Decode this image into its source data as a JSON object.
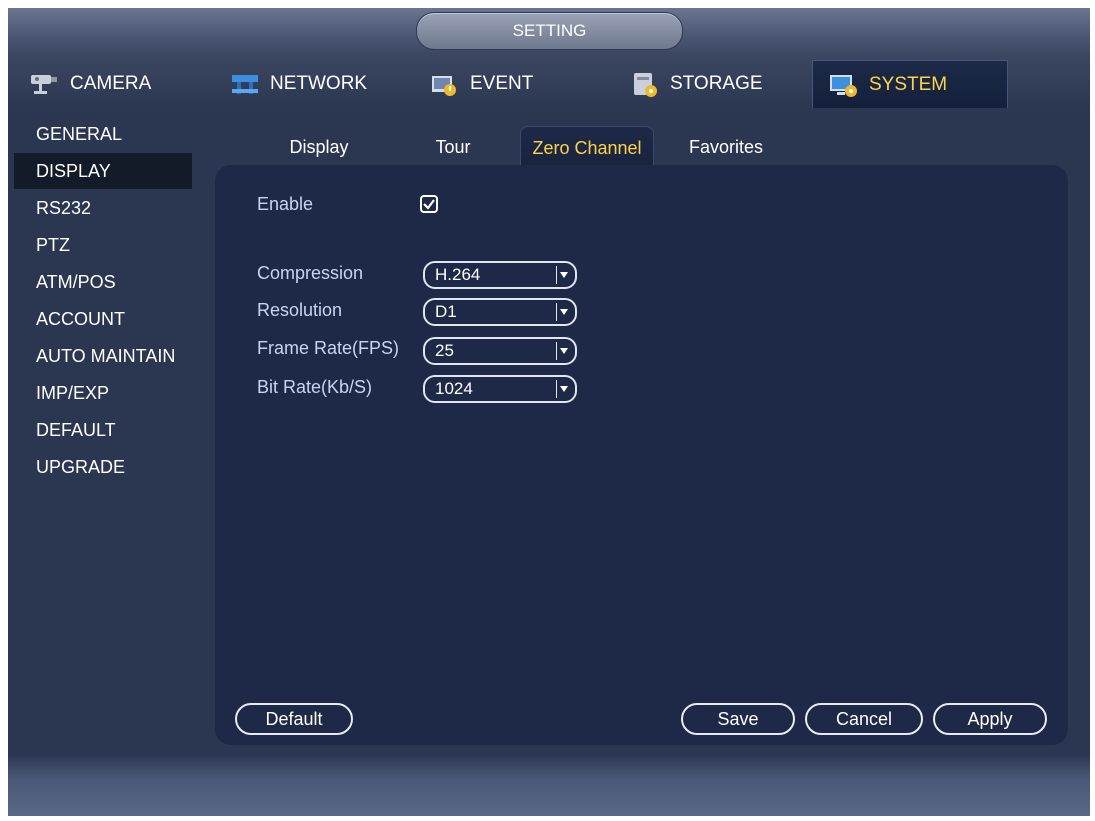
{
  "window": {
    "title": "SETTING"
  },
  "topnav": {
    "items": [
      {
        "label": "CAMERA",
        "icon": "camera-icon"
      },
      {
        "label": "NETWORK",
        "icon": "network-icon"
      },
      {
        "label": "EVENT",
        "icon": "event-icon"
      },
      {
        "label": "STORAGE",
        "icon": "storage-icon"
      },
      {
        "label": "SYSTEM",
        "icon": "system-icon"
      }
    ],
    "active": "SYSTEM",
    "active_color": "#ffd24a"
  },
  "sidebar": {
    "items": [
      {
        "label": "GENERAL"
      },
      {
        "label": "DISPLAY"
      },
      {
        "label": "RS232"
      },
      {
        "label": "PTZ"
      },
      {
        "label": "ATM/POS"
      },
      {
        "label": "ACCOUNT"
      },
      {
        "label": "AUTO MAINTAIN"
      },
      {
        "label": "IMP/EXP"
      },
      {
        "label": "DEFAULT"
      },
      {
        "label": "UPGRADE"
      }
    ],
    "active": "DISPLAY"
  },
  "subtabs": {
    "items": [
      {
        "label": "Display"
      },
      {
        "label": "Tour"
      },
      {
        "label": "Zero Channel"
      },
      {
        "label": "Favorites"
      }
    ],
    "active": "Zero Channel"
  },
  "form": {
    "enable": {
      "label": "Enable",
      "checked": true
    },
    "compression": {
      "label": "Compression",
      "value": "H.264"
    },
    "resolution": {
      "label": "Resolution",
      "value": "D1"
    },
    "frame_rate": {
      "label": "Frame Rate(FPS)",
      "value": "25"
    },
    "bit_rate": {
      "label": "Bit Rate(Kb/S)",
      "value": "1024"
    }
  },
  "buttons": {
    "default": "Default",
    "save": "Save",
    "cancel": "Cancel",
    "apply": "Apply"
  }
}
